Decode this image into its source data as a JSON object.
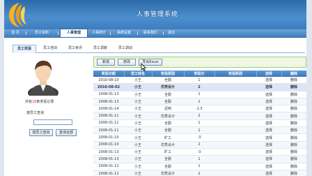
{
  "app": {
    "title": "人事管理系统"
  },
  "nav": {
    "items": [
      {
        "label": "首 页"
      },
      {
        "label": "员工资料"
      },
      {
        "label": "人事管理"
      },
      {
        "label": "人事统计"
      },
      {
        "label": "系统设置"
      },
      {
        "label": "联系我们"
      },
      {
        "label": "退出"
      }
    ]
  },
  "subnav": {
    "tabs": [
      {
        "label": "员工奖惩"
      },
      {
        "label": "员工培训"
      },
      {
        "label": "员工考评"
      },
      {
        "label": "员工调薪"
      },
      {
        "label": "员工调动"
      }
    ]
  },
  "left": {
    "count_prefix": "共有",
    "count_value": "28",
    "count_suffix": "条奖惩记录",
    "query_title": "按员工查询",
    "query_value": "",
    "query_button": "按员工查询",
    "all_button": "查询全部"
  },
  "toolbar": {
    "add": "新增",
    "edit": "修改",
    "export": "导出Excel"
  },
  "table": {
    "headers": [
      "奖惩日期",
      "员工姓名",
      "奖惩原因",
      "奖惩分",
      "奖惩原因",
      "选择",
      "删除"
    ],
    "rows": [
      [
        "2010-08-10",
        "小王",
        "全勤",
        "1",
        "",
        "选择",
        "删除"
      ],
      [
        "2010-08-02",
        "小王",
        "优秀设计",
        "2",
        "",
        "选择",
        "删除"
      ],
      [
        "2008-01-13",
        "小王",
        "全勤",
        "1",
        "",
        "选择",
        "删除"
      ],
      [
        "2008-01-13",
        "小王",
        "全勤",
        "1",
        "",
        "选择",
        "删除"
      ],
      [
        "2008-01-14",
        "小王",
        "迟到",
        "-1.5",
        "",
        "选择",
        "删除"
      ],
      [
        "2008-01-11",
        "小王",
        "优秀设计",
        "2",
        "",
        "选择",
        "删除"
      ],
      [
        "2008-01-11",
        "小王",
        "全勤",
        "1",
        "",
        "选择",
        "删除"
      ],
      [
        "2008-01-11",
        "小王",
        "全勤",
        "1",
        "",
        "选择",
        "删除"
      ],
      [
        "2008-01-10",
        "小王",
        "旷工",
        "-3",
        "",
        "选择",
        "删除"
      ],
      [
        "2008-01-10",
        "小王",
        "优秀设计",
        "2",
        "",
        "选择",
        "删除"
      ],
      [
        "2008-01-13",
        "小王",
        "旷工",
        "-3",
        "",
        "选择",
        "删除"
      ],
      [
        "2008-01-13",
        "小王",
        "全勤",
        "1",
        "",
        "选择",
        "删除"
      ],
      [
        "2008-01-12",
        "小王",
        "全勤",
        "1",
        "",
        "选择",
        "删除"
      ],
      [
        "2008-01-12",
        "小王",
        "优秀设计",
        "2",
        "",
        "选择",
        "删除"
      ]
    ]
  },
  "colors": {
    "header_blue": "#3d7cc0",
    "toolbar_green": "#eef6e4",
    "accent_red": "#e33"
  }
}
